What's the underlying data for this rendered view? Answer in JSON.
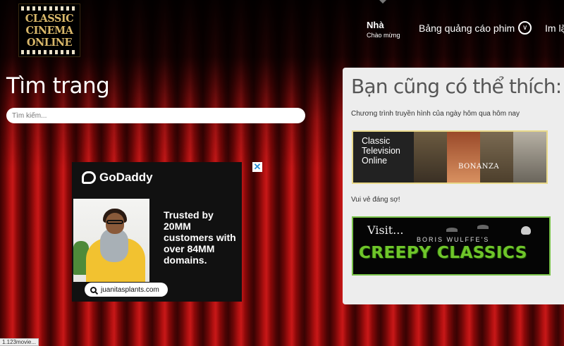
{
  "header": {
    "logo_lines": [
      "CLASSIC",
      "CINEMA",
      "ONLINE"
    ],
    "nav": {
      "home_label": "Nhà",
      "home_sub": "Chào mừng",
      "board_label": "Bảng quảng cáo phim",
      "more_label": "Im lặ"
    }
  },
  "search": {
    "title": "Tìm trang",
    "placeholder": "Tìm kiếm..."
  },
  "ad": {
    "brand": "GoDaddy",
    "copy": "Trusted by 20MM customers with over 84MM domains.",
    "domain": "juanitasplants.com",
    "close_symbol": "✕"
  },
  "panel": {
    "heading": "Bạn cũng có thể thích:",
    "caption1": "Chương trình truyền hình của ngày hôm qua hôm nay",
    "banner1_lines": [
      "Classic",
      "Television",
      "Online"
    ],
    "banner1_show": "BONANZA",
    "caption2": "Vui vẻ đáng sợ!",
    "banner2_visit": "Visit...",
    "banner2_author": "BORIS WULFFE'S",
    "banner2_title": "CREEPY CLASSICS"
  },
  "status_text": "1.123movie...",
  "colors": {
    "curtain": "#b01010",
    "panel_bg": "#ededed",
    "creepy_green": "#6fc52a",
    "logo_gold": "#d9b86a"
  }
}
